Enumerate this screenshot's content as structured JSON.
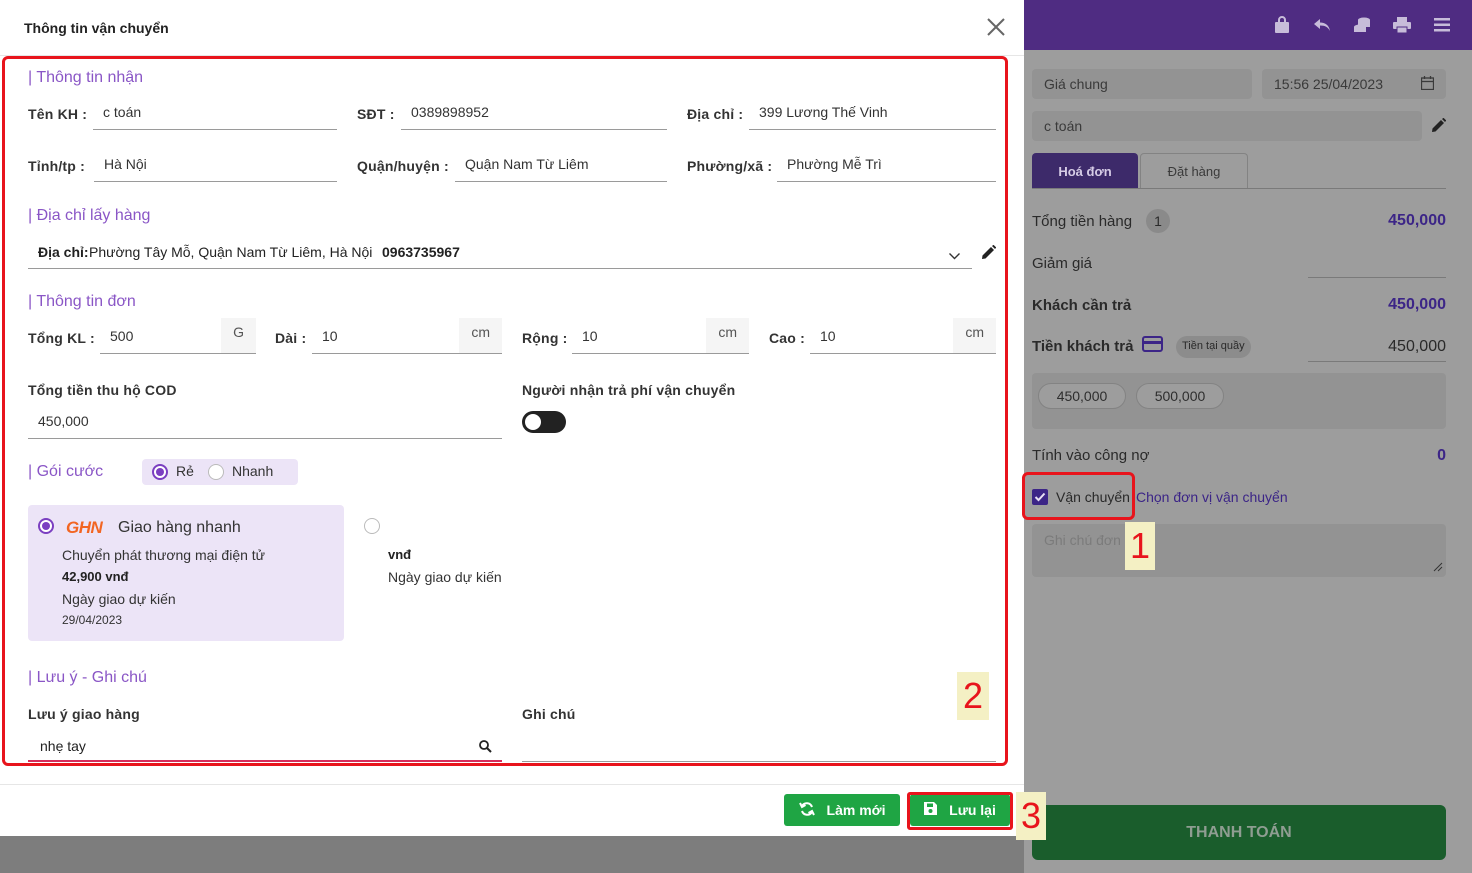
{
  "modal": {
    "title": "Thông tin vận chuyển",
    "close_icon": "close-icon"
  },
  "receive": {
    "section_title": "| Thông tin nhận",
    "name_label": "Tên KH :",
    "name_value": "c toán",
    "phone_label": "SĐT :",
    "phone_value": "0389898952",
    "address_label": "Địa chỉ :",
    "address_value": "399 Lương Thế Vinh",
    "city_label": "Tỉnh/tp :",
    "city_value": "Hà Nội",
    "district_label": "Quận/huyện :",
    "district_value": "Quận Nam Từ Liêm",
    "ward_label": "Phường/xã :",
    "ward_value": "Phường Mễ Trì"
  },
  "pickup": {
    "section_title": "| Địa chỉ lấy hàng",
    "address_label": "Địa chỉ:",
    "address_value": "Phường Tây Mỗ, Quận Nam Từ Liêm, Hà Nội",
    "phone": "0963735967"
  },
  "order": {
    "section_title": "| Thông tin đơn",
    "weight_label": "Tổng KL :",
    "weight_value": "500",
    "weight_unit": "G",
    "length_label": "Dài :",
    "length_value": "10",
    "length_unit": "cm",
    "width_label": "Rộng :",
    "width_value": "10",
    "width_unit": "cm",
    "height_label": "Cao :",
    "height_value": "10",
    "height_unit": "cm",
    "cod_label": "Tổng tiền thu hộ COD",
    "cod_value": "450,000",
    "fee_label": "Người nhận trả phí vận chuyển",
    "fee_toggle_on": false
  },
  "package": {
    "section_title": "| Gói cước",
    "options": [
      "Rẻ",
      "Nhanh"
    ],
    "selected": "Rẻ"
  },
  "carriers": [
    {
      "logo": "GHN",
      "name": "Giao hàng nhanh",
      "service": "Chuyển phát thương mại điện tử",
      "price": "42,900 vnđ",
      "eta_label": "Ngày giao dự kiến",
      "eta": "29/04/2023",
      "selected": true
    },
    {
      "price": "vnđ",
      "eta_label": "Ngày giao dự kiến",
      "selected": false
    }
  ],
  "notes": {
    "section_title": "| Lưu ý - Ghi chú",
    "delivery_note_label": "Lưu ý giao hàng",
    "delivery_note_value": "nhẹ tay",
    "note_label": "Ghi chú",
    "note_value": ""
  },
  "footer": {
    "refresh_label": "Làm mới",
    "save_label": "Lưu lại"
  },
  "pos": {
    "price_list": "Giá chung",
    "datetime": "15:56 25/04/2023",
    "customer": "c toán",
    "tab_invoice": "Hoá đơn",
    "tab_order": "Đặt hàng",
    "total_goods_label": "Tổng tiền hàng",
    "total_goods_count": "1",
    "total_goods_value": "450,000",
    "discount_label": "Giảm giá",
    "customer_pays_label": "Khách cần trả",
    "customer_pays_value": "450,000",
    "customer_paid_label": "Tiền khách trả",
    "payment_method": "Tiền tại quầy",
    "customer_paid_value": "450,000",
    "quick_amounts": [
      "450,000",
      "500,000"
    ],
    "debt_label": "Tính vào công nợ",
    "debt_value": "0",
    "shipping_label": "Vận chuyển",
    "shipping_checked": true,
    "choose_carrier": "Chọn đơn vị vận chuyển",
    "order_note_placeholder": "Ghi chú đơn hàng",
    "checkout_label": "THANH TOÁN"
  },
  "annotations": [
    "1",
    "2",
    "3"
  ],
  "colors": {
    "accent": "#7b3fc1",
    "section_title": "#8a56c6",
    "button_green": "#1fa544",
    "annotation_red": "#e8141c",
    "topbar": "#4f2c82"
  }
}
